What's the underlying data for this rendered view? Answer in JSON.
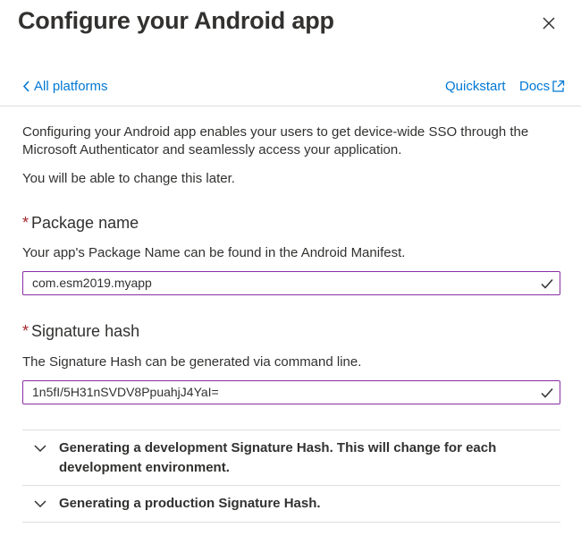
{
  "header": {
    "title": "Configure your Android app"
  },
  "nav": {
    "back_label": "All platforms",
    "quickstart_label": "Quickstart",
    "docs_label": "Docs"
  },
  "intro": {
    "description": "Configuring your Android app enables your users to get device-wide SSO through the Microsoft Authenticator and seamlessly access your application.",
    "note": "You will be able to change this later."
  },
  "package_field": {
    "required_mark": "*",
    "label": "Package name",
    "helper": "Your app's Package Name can be found in the Android Manifest.",
    "value": "com.esm2019.myapp"
  },
  "signature_field": {
    "required_mark": "*",
    "label": "Signature hash",
    "helper": "The Signature Hash can be generated via command line.",
    "value": "1n5fI/5H31nSVDV8PpuahjJ4YaI="
  },
  "accordion": {
    "items": [
      {
        "label": "Generating a development Signature Hash. This will change for each development environment."
      },
      {
        "label": "Generating a production Signature Hash."
      }
    ]
  },
  "colors": {
    "accent": "#0078d4",
    "input_border": "#8a2da5",
    "required": "#a4262c",
    "text": "#323130",
    "divider": "#e1dfdd"
  },
  "icons": {
    "close": "close-icon",
    "back": "chevron-left-icon",
    "docs": "external-link-icon",
    "valid": "checkmark-icon",
    "expand": "chevron-down-icon"
  }
}
